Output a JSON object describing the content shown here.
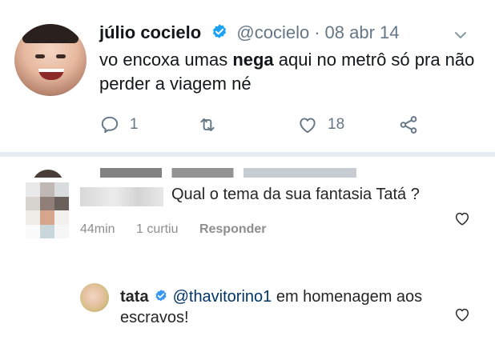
{
  "tweet": {
    "name": "júlio cocielo",
    "handle": "@cocielo",
    "separator": "·",
    "date": "08 abr 14",
    "text_before": "vo encoxa umas ",
    "text_bold": "nega",
    "text_after": " aqui no metrô só pra não perder a viagem né",
    "reply_count": "1",
    "like_count": "18",
    "verified_color": "#1da1f2"
  },
  "comments": [
    {
      "text": "Qual o tema da sua fantasia Tatá ?",
      "time": "44min",
      "likes": "1 curtiu",
      "reply_label": "Responder"
    },
    {
      "username": "tata",
      "mention": "@thavitorino1",
      "text": " em homenagem aos escravos!"
    }
  ],
  "icons": {
    "reply": "reply-icon",
    "retweet": "retweet-icon",
    "like": "like-heart-icon",
    "share": "share-icon",
    "caret": "chevron-down-icon",
    "verified": "verified-badge-icon",
    "comment_like": "heart-outline-icon"
  }
}
